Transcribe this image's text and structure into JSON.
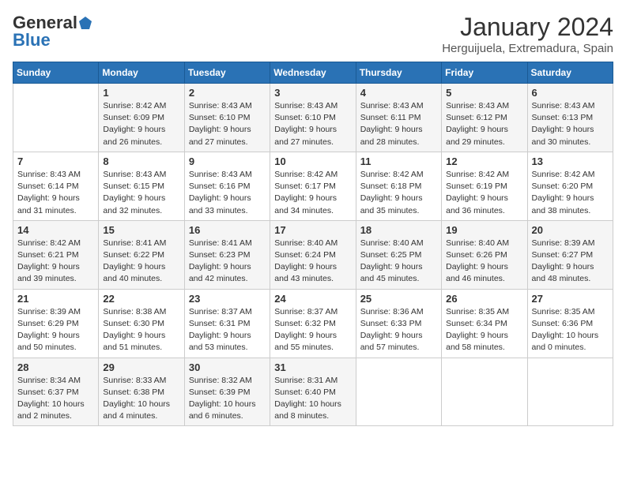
{
  "logo": {
    "general": "General",
    "blue": "Blue"
  },
  "header": {
    "month": "January 2024",
    "location": "Herguijuela, Extremadura, Spain"
  },
  "weekdays": [
    "Sunday",
    "Monday",
    "Tuesday",
    "Wednesday",
    "Thursday",
    "Friday",
    "Saturday"
  ],
  "weeks": [
    [
      {
        "day": "",
        "sunrise": "",
        "sunset": "",
        "daylight": ""
      },
      {
        "day": "1",
        "sunrise": "Sunrise: 8:42 AM",
        "sunset": "Sunset: 6:09 PM",
        "daylight": "Daylight: 9 hours and 26 minutes."
      },
      {
        "day": "2",
        "sunrise": "Sunrise: 8:43 AM",
        "sunset": "Sunset: 6:10 PM",
        "daylight": "Daylight: 9 hours and 27 minutes."
      },
      {
        "day": "3",
        "sunrise": "Sunrise: 8:43 AM",
        "sunset": "Sunset: 6:10 PM",
        "daylight": "Daylight: 9 hours and 27 minutes."
      },
      {
        "day": "4",
        "sunrise": "Sunrise: 8:43 AM",
        "sunset": "Sunset: 6:11 PM",
        "daylight": "Daylight: 9 hours and 28 minutes."
      },
      {
        "day": "5",
        "sunrise": "Sunrise: 8:43 AM",
        "sunset": "Sunset: 6:12 PM",
        "daylight": "Daylight: 9 hours and 29 minutes."
      },
      {
        "day": "6",
        "sunrise": "Sunrise: 8:43 AM",
        "sunset": "Sunset: 6:13 PM",
        "daylight": "Daylight: 9 hours and 30 minutes."
      }
    ],
    [
      {
        "day": "7",
        "sunrise": "Sunrise: 8:43 AM",
        "sunset": "Sunset: 6:14 PM",
        "daylight": "Daylight: 9 hours and 31 minutes."
      },
      {
        "day": "8",
        "sunrise": "Sunrise: 8:43 AM",
        "sunset": "Sunset: 6:15 PM",
        "daylight": "Daylight: 9 hours and 32 minutes."
      },
      {
        "day": "9",
        "sunrise": "Sunrise: 8:43 AM",
        "sunset": "Sunset: 6:16 PM",
        "daylight": "Daylight: 9 hours and 33 minutes."
      },
      {
        "day": "10",
        "sunrise": "Sunrise: 8:42 AM",
        "sunset": "Sunset: 6:17 PM",
        "daylight": "Daylight: 9 hours and 34 minutes."
      },
      {
        "day": "11",
        "sunrise": "Sunrise: 8:42 AM",
        "sunset": "Sunset: 6:18 PM",
        "daylight": "Daylight: 9 hours and 35 minutes."
      },
      {
        "day": "12",
        "sunrise": "Sunrise: 8:42 AM",
        "sunset": "Sunset: 6:19 PM",
        "daylight": "Daylight: 9 hours and 36 minutes."
      },
      {
        "day": "13",
        "sunrise": "Sunrise: 8:42 AM",
        "sunset": "Sunset: 6:20 PM",
        "daylight": "Daylight: 9 hours and 38 minutes."
      }
    ],
    [
      {
        "day": "14",
        "sunrise": "Sunrise: 8:42 AM",
        "sunset": "Sunset: 6:21 PM",
        "daylight": "Daylight: 9 hours and 39 minutes."
      },
      {
        "day": "15",
        "sunrise": "Sunrise: 8:41 AM",
        "sunset": "Sunset: 6:22 PM",
        "daylight": "Daylight: 9 hours and 40 minutes."
      },
      {
        "day": "16",
        "sunrise": "Sunrise: 8:41 AM",
        "sunset": "Sunset: 6:23 PM",
        "daylight": "Daylight: 9 hours and 42 minutes."
      },
      {
        "day": "17",
        "sunrise": "Sunrise: 8:40 AM",
        "sunset": "Sunset: 6:24 PM",
        "daylight": "Daylight: 9 hours and 43 minutes."
      },
      {
        "day": "18",
        "sunrise": "Sunrise: 8:40 AM",
        "sunset": "Sunset: 6:25 PM",
        "daylight": "Daylight: 9 hours and 45 minutes."
      },
      {
        "day": "19",
        "sunrise": "Sunrise: 8:40 AM",
        "sunset": "Sunset: 6:26 PM",
        "daylight": "Daylight: 9 hours and 46 minutes."
      },
      {
        "day": "20",
        "sunrise": "Sunrise: 8:39 AM",
        "sunset": "Sunset: 6:27 PM",
        "daylight": "Daylight: 9 hours and 48 minutes."
      }
    ],
    [
      {
        "day": "21",
        "sunrise": "Sunrise: 8:39 AM",
        "sunset": "Sunset: 6:29 PM",
        "daylight": "Daylight: 9 hours and 50 minutes."
      },
      {
        "day": "22",
        "sunrise": "Sunrise: 8:38 AM",
        "sunset": "Sunset: 6:30 PM",
        "daylight": "Daylight: 9 hours and 51 minutes."
      },
      {
        "day": "23",
        "sunrise": "Sunrise: 8:37 AM",
        "sunset": "Sunset: 6:31 PM",
        "daylight": "Daylight: 9 hours and 53 minutes."
      },
      {
        "day": "24",
        "sunrise": "Sunrise: 8:37 AM",
        "sunset": "Sunset: 6:32 PM",
        "daylight": "Daylight: 9 hours and 55 minutes."
      },
      {
        "day": "25",
        "sunrise": "Sunrise: 8:36 AM",
        "sunset": "Sunset: 6:33 PM",
        "daylight": "Daylight: 9 hours and 57 minutes."
      },
      {
        "day": "26",
        "sunrise": "Sunrise: 8:35 AM",
        "sunset": "Sunset: 6:34 PM",
        "daylight": "Daylight: 9 hours and 58 minutes."
      },
      {
        "day": "27",
        "sunrise": "Sunrise: 8:35 AM",
        "sunset": "Sunset: 6:36 PM",
        "daylight": "Daylight: 10 hours and 0 minutes."
      }
    ],
    [
      {
        "day": "28",
        "sunrise": "Sunrise: 8:34 AM",
        "sunset": "Sunset: 6:37 PM",
        "daylight": "Daylight: 10 hours and 2 minutes."
      },
      {
        "day": "29",
        "sunrise": "Sunrise: 8:33 AM",
        "sunset": "Sunset: 6:38 PM",
        "daylight": "Daylight: 10 hours and 4 minutes."
      },
      {
        "day": "30",
        "sunrise": "Sunrise: 8:32 AM",
        "sunset": "Sunset: 6:39 PM",
        "daylight": "Daylight: 10 hours and 6 minutes."
      },
      {
        "day": "31",
        "sunrise": "Sunrise: 8:31 AM",
        "sunset": "Sunset: 6:40 PM",
        "daylight": "Daylight: 10 hours and 8 minutes."
      },
      {
        "day": "",
        "sunrise": "",
        "sunset": "",
        "daylight": ""
      },
      {
        "day": "",
        "sunrise": "",
        "sunset": "",
        "daylight": ""
      },
      {
        "day": "",
        "sunrise": "",
        "sunset": "",
        "daylight": ""
      }
    ]
  ]
}
